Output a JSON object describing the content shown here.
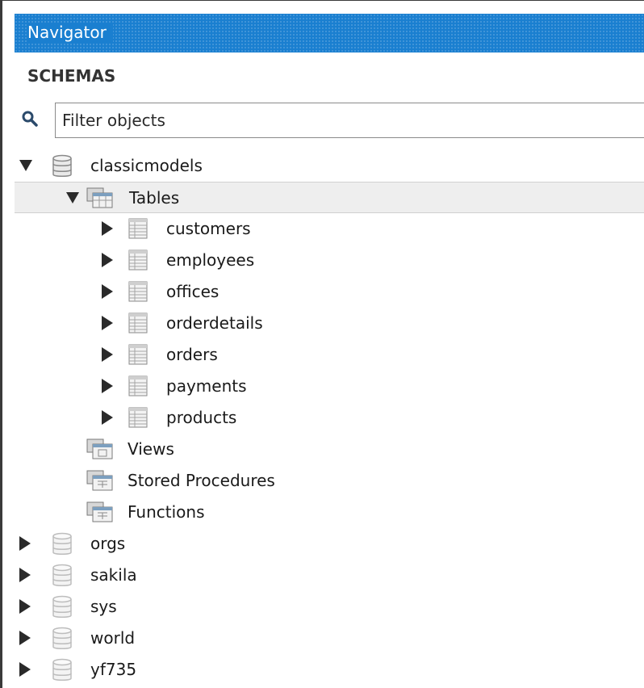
{
  "navigator": {
    "title": "Navigator",
    "section": "SCHEMAS",
    "filter_placeholder": "Filter objects"
  },
  "schemas": [
    {
      "name": "classicmodels",
      "expanded": true
    },
    {
      "name": "orgs",
      "expanded": false
    },
    {
      "name": "sakila",
      "expanded": false
    },
    {
      "name": "sys",
      "expanded": false
    },
    {
      "name": "world",
      "expanded": false
    },
    {
      "name": "yf735",
      "expanded": false
    }
  ],
  "classicmodels": {
    "tables_label": "Tables",
    "tables": [
      "customers",
      "employees",
      "offices",
      "orderdetails",
      "orders",
      "payments",
      "products"
    ],
    "views_label": "Views",
    "procedures_label": "Stored Procedures",
    "functions_label": "Functions"
  },
  "colors": {
    "header": "#1a7fd0",
    "selection": "#eeeeee"
  }
}
